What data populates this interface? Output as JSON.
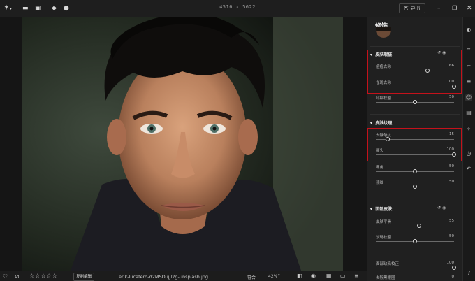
{
  "toolbar": {
    "image_dimensions": "4516  x  5622",
    "export_label": "导出",
    "icons": [
      "logo-icon",
      "folder-icon",
      "image-icon",
      "eraser-icon",
      "brush-icon",
      "share-icon",
      "minimize-icon",
      "maximize-icon",
      "close-icon"
    ]
  },
  "panel": {
    "title": "修饰",
    "sections": [
      {
        "name": "皮肤瑕疵"
      },
      {
        "name": "皮肤纹理"
      },
      {
        "name": "面部皮肤"
      }
    ],
    "sliders": [
      {
        "label": "痘痘去除",
        "value": "66",
        "fraction": 0.66
      },
      {
        "label": "雀斑去除",
        "value": "100",
        "fraction": 1.0
      },
      {
        "label": "印痕祛圈",
        "value": "50",
        "fraction": 0.5
      },
      {
        "label": "去除皱纹",
        "value": "15",
        "fraction": 0.15
      },
      {
        "label": "额头",
        "value": "100",
        "fraction": 1.0
      },
      {
        "label": "嘴角",
        "value": "50",
        "fraction": 0.5
      },
      {
        "label": "颈纹",
        "value": "50",
        "fraction": 0.5
      },
      {
        "label": "皮肤平滑",
        "value": "55",
        "fraction": 0.55
      },
      {
        "label": "淡斑祛圈",
        "value": "50",
        "fraction": 0.5
      },
      {
        "label": "面部缺陷校正",
        "value": "100",
        "fraction": 1.0
      },
      {
        "label": "去除黑眼圈",
        "value": "0",
        "fraction": 0.0
      }
    ]
  },
  "bottombar": {
    "tag_label": "复制编辑",
    "filename": "erik-lucatero-d2MSDujJl2g-unsplash.jpg",
    "fit_label": "符合",
    "zoom": "42%",
    "stars": [
      "☆",
      "☆",
      "☆",
      "☆",
      "☆"
    ]
  },
  "colors": {
    "highlight": "#c4121b",
    "background": "#1b1b1b",
    "panel": "#202020"
  }
}
